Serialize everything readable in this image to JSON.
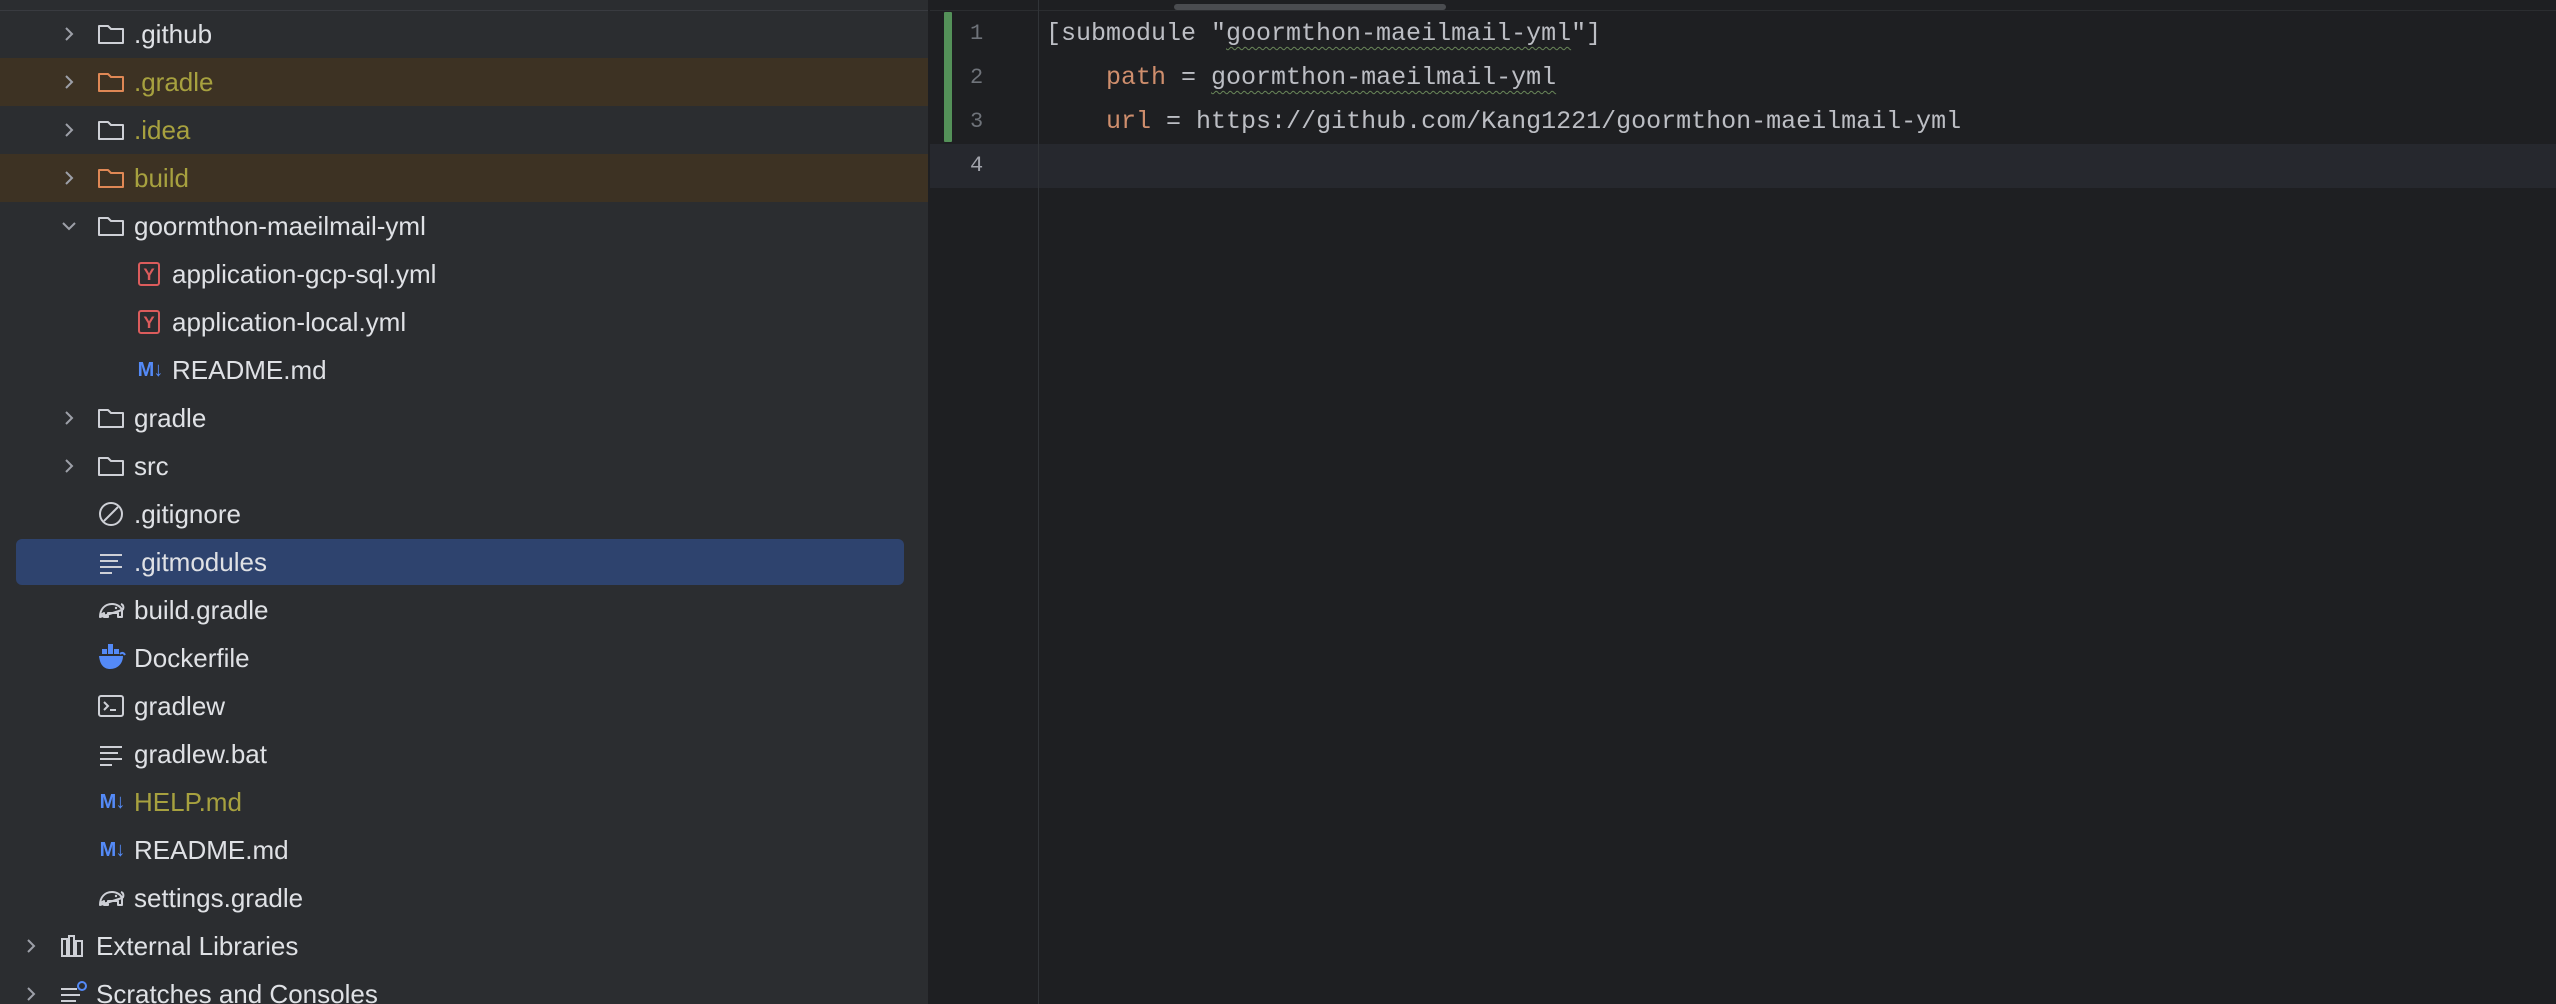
{
  "tree": {
    "items": [
      {
        "label": ".github",
        "icon": "folder-icon",
        "expanded": false
      },
      {
        "label": ".gradle",
        "icon": "folder-icon",
        "expanded": false,
        "status": "ignored"
      },
      {
        "label": ".idea",
        "icon": "folder-icon",
        "expanded": false
      },
      {
        "label": "build",
        "icon": "folder-icon",
        "expanded": false,
        "status": "ignored"
      },
      {
        "label": "goormthon-maeilmail-yml",
        "icon": "folder-icon",
        "expanded": true
      },
      {
        "label": "application-gcp-sql.yml",
        "icon": "yaml-file-icon"
      },
      {
        "label": "application-local.yml",
        "icon": "yaml-file-icon"
      },
      {
        "label": "README.md",
        "icon": "markdown-file-icon"
      },
      {
        "label": "gradle",
        "icon": "folder-icon",
        "expanded": false
      },
      {
        "label": "src",
        "icon": "folder-icon",
        "expanded": false
      },
      {
        "label": ".gitignore",
        "icon": "ignore-file-icon"
      },
      {
        "label": ".gitmodules",
        "icon": "text-file-icon",
        "selected": true
      },
      {
        "label": "build.gradle",
        "icon": "gradle-elephant-icon"
      },
      {
        "label": "Dockerfile",
        "icon": "docker-whale-icon"
      },
      {
        "label": "gradlew",
        "icon": "shell-script-icon"
      },
      {
        "label": "gradlew.bat",
        "icon": "text-file-icon"
      },
      {
        "label": "HELP.md",
        "icon": "markdown-file-icon",
        "status": "unversioned"
      },
      {
        "label": "README.md",
        "icon": "markdown-file-icon"
      },
      {
        "label": "settings.gradle",
        "icon": "gradle-elephant-icon"
      },
      {
        "label": "External Libraries",
        "icon": "library-icon",
        "expanded": false
      },
      {
        "label": "Scratches and Consoles",
        "icon": "scratches-icon",
        "expanded": false
      }
    ],
    "markdown_glyph": "M↓",
    "yaml_glyph": "Y"
  },
  "editor": {
    "line_numbers": [
      "1",
      "2",
      "3",
      "4"
    ],
    "lines": [
      {
        "open": "[submodule \"",
        "name": "goormthon-maeilmail-yml",
        "close": "\"]"
      },
      {
        "indent": "    ",
        "key": "path",
        "eq": " = ",
        "value": "goormthon-maeilmail-yml"
      },
      {
        "indent": "    ",
        "key": "url",
        "eq": " = ",
        "value": "https://github.com/Kang1221/goormthon-maeilmail-yml"
      },
      {}
    ]
  },
  "colors": {
    "tree_bg": "#2b2d30",
    "editor_bg": "#1e1f22",
    "selection": "#2e436e",
    "ignored_bg": "#3d3223",
    "ignored_text": "#a7a13f",
    "keyword": "#cf8e6d",
    "vcs_added": "#549159"
  }
}
